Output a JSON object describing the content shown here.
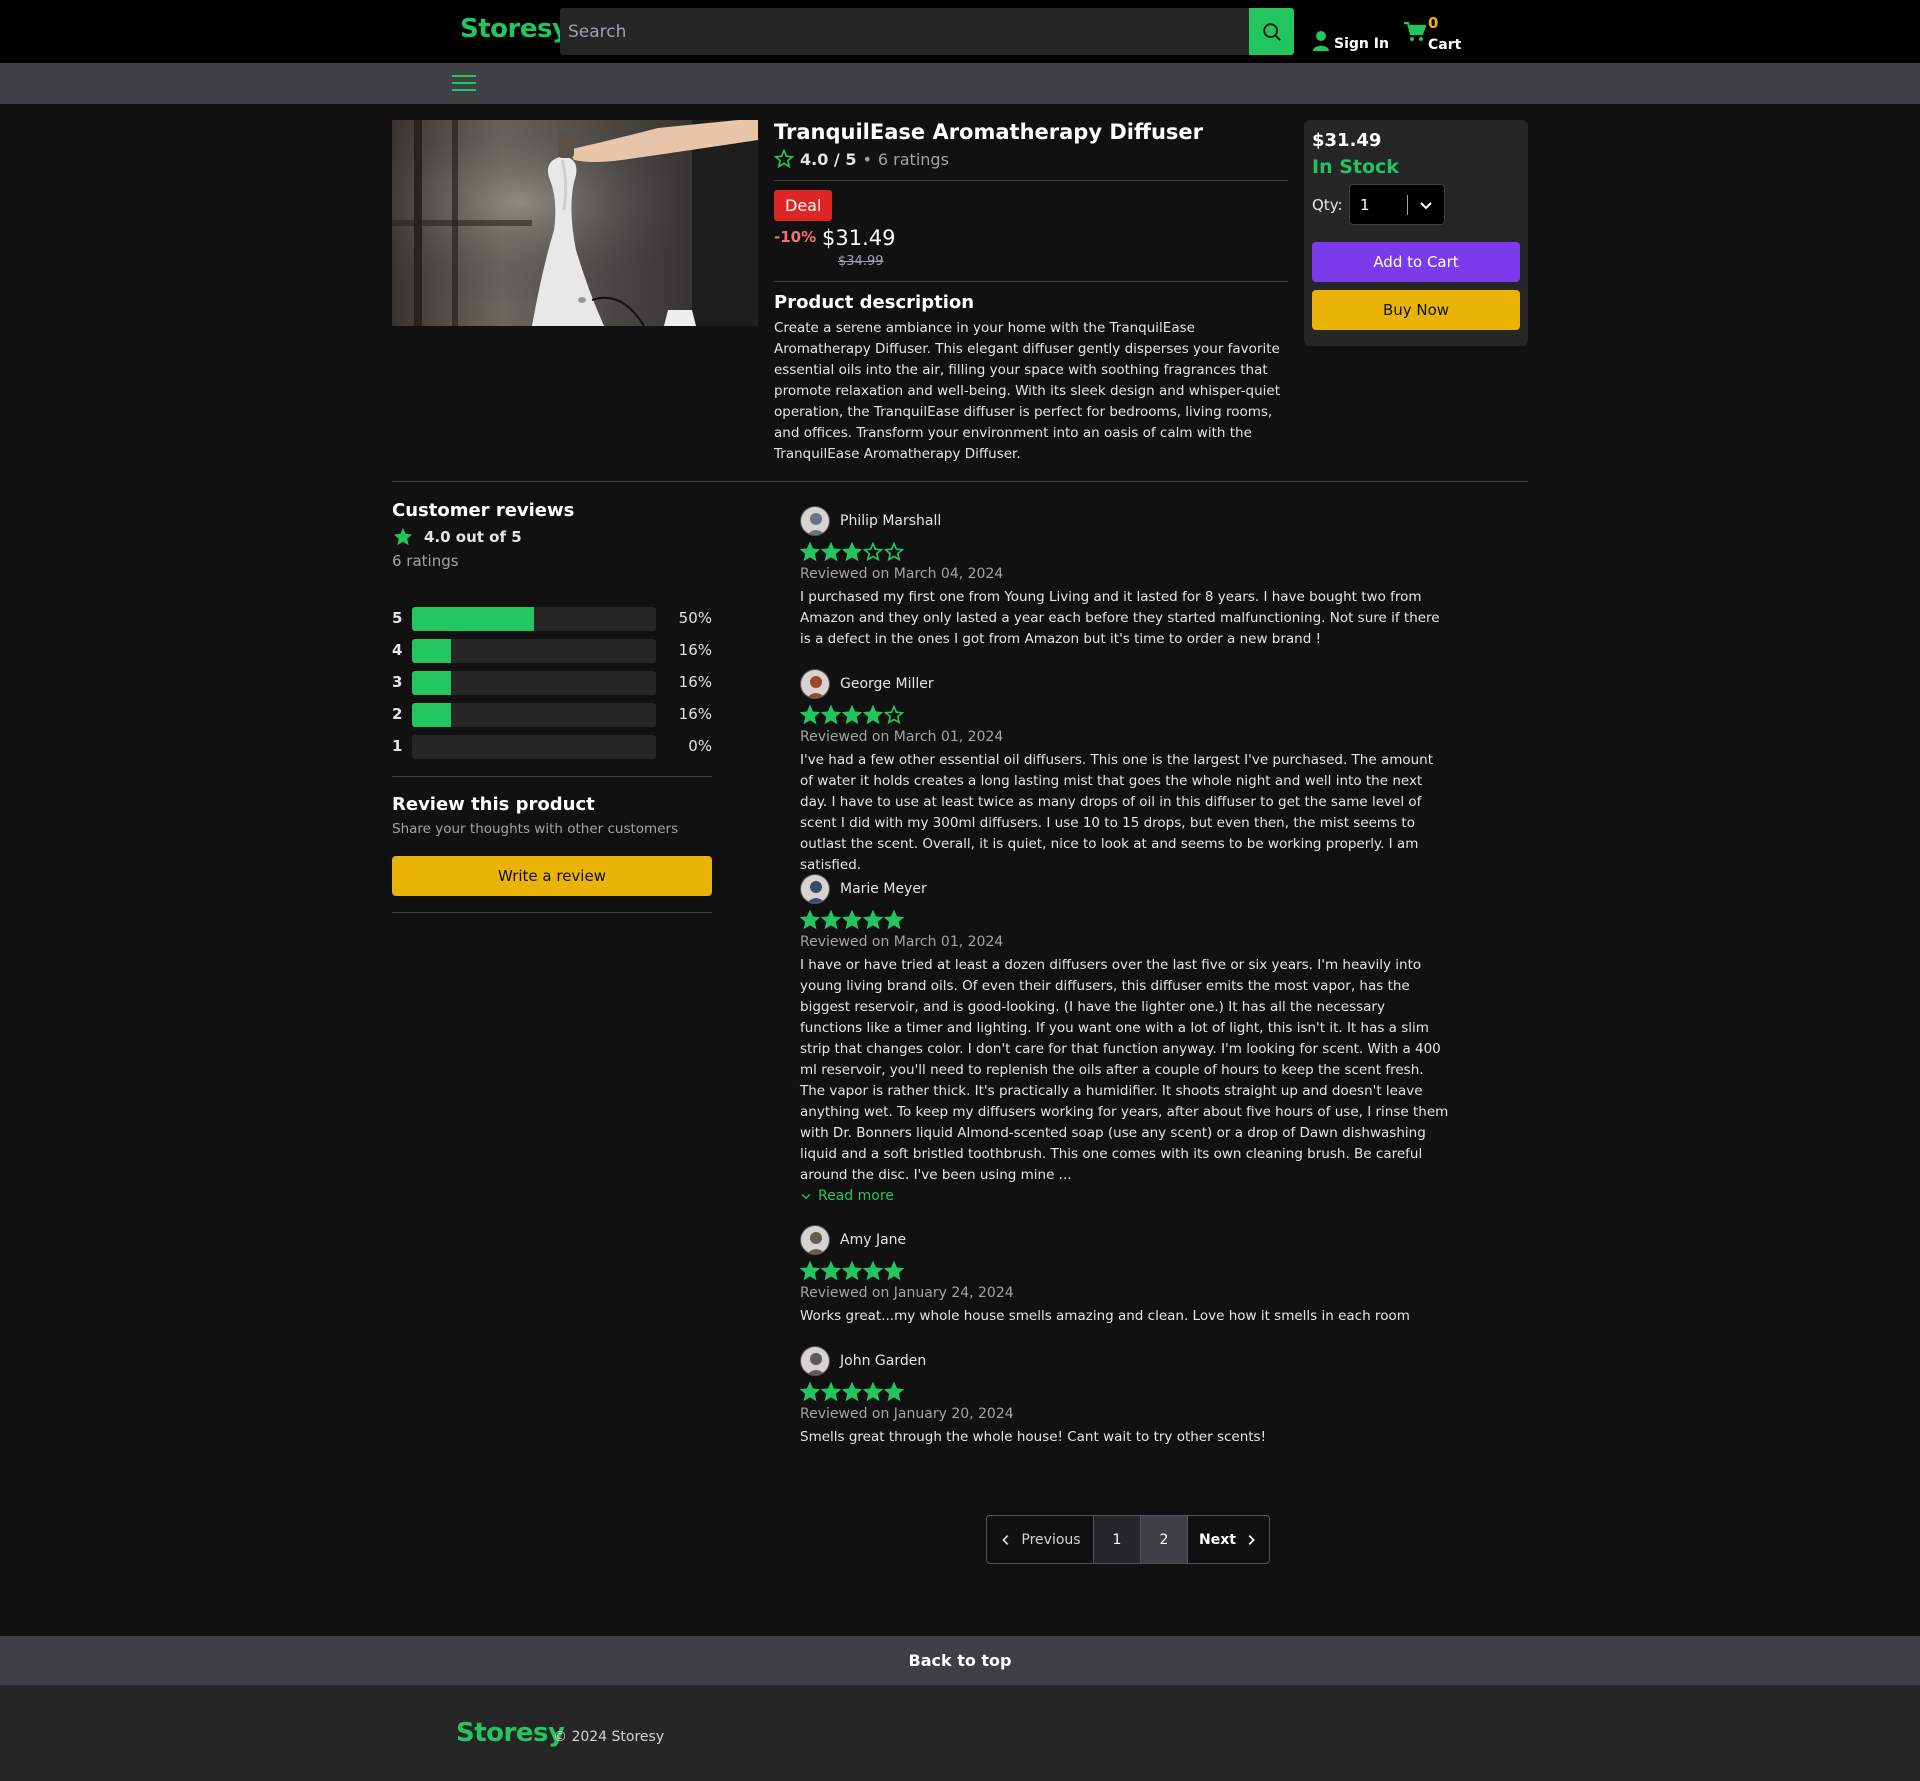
{
  "header": {
    "logo": "Storesy",
    "search_placeholder": "Search",
    "signin_label": "Sign In",
    "cart_count": "0",
    "cart_label": "Cart"
  },
  "product": {
    "title": "TranquilEase Aromatherapy Diffuser",
    "rating": "4.0 / 5",
    "rating_count": "6 ratings",
    "deal_badge": "Deal",
    "discount": "-10%",
    "price": "$31.49",
    "old_price": "$34.99",
    "description_title": "Product description",
    "description": "Create a serene ambiance in your home with the TranquilEase Aromatherapy Diffuser. This elegant diffuser gently disperses your favorite essential oils into the air, filling your space with soothing fragrances that promote relaxation and well-being. With its sleek design and whisper-quiet operation, the TranquilEase diffuser is perfect for bedrooms, living rooms, and offices. Transform your environment into an oasis of calm with the TranquilEase Aromatherapy Diffuser."
  },
  "buybox": {
    "price": "$31.49",
    "stock": "In Stock",
    "qty_label": "Qty:",
    "qty_value": "1",
    "add_to_cart": "Add to Cart",
    "buy_now": "Buy Now"
  },
  "summary": {
    "title": "Customer reviews",
    "rating": "4.0 out of 5",
    "count": "6 ratings",
    "bars": [
      {
        "star": "5",
        "pct": "50%",
        "fill": 0.5
      },
      {
        "star": "4",
        "pct": "16%",
        "fill": 0.16
      },
      {
        "star": "3",
        "pct": "16%",
        "fill": 0.16
      },
      {
        "star": "2",
        "pct": "16%",
        "fill": 0.16
      },
      {
        "star": "1",
        "pct": "0%",
        "fill": 0
      }
    ],
    "review_title": "Review this product",
    "review_sub": "Share your thoughts with other customers",
    "write_review": "Write a review"
  },
  "reviews": [
    {
      "name": "Philip Marshall",
      "stars": 3,
      "date": "Reviewed on March 04, 2024",
      "body": "I purchased my first one from Young Living and it lasted for 8 years. I have bought two from Amazon and they only lasted a year each before they started malfunctioning. Not sure if there is a defect in the ones I got from Amazon but it's time to order a new brand !"
    },
    {
      "name": "George Miller",
      "stars": 4,
      "date": "Reviewed on March 01, 2024",
      "body": "I've had a few other essential oil diffusers. This one is the largest I've purchased. The amount of water it holds creates a long lasting mist that goes the whole night and well into the next day. I have to use at least twice as many drops of oil in this diffuser to get the same level of scent I did with my 300ml diffusers. I use 10 to 15 drops, but even then, the mist seems to outlast the scent. Overall, it is quiet, nice to look at and seems to be working properly. I am satisfied."
    },
    {
      "name": "Marie Meyer",
      "stars": 5,
      "date": "Reviewed on March 01, 2024",
      "body": "I have or have tried at least a dozen diffusers over the last five or six years. I'm heavily into young living brand oils. Of even their diffusers, this diffuser emits the most vapor, has the biggest reservoir, and is good-looking. (I have the lighter one.) It has all the necessary functions like a timer and lighting. If you want one with a lot of light, this isn't it. It has a slim strip that changes color. I don't care for that function anyway. I'm looking for scent. With a 400 ml reservoir, you'll need to replenish the oils after a couple of hours to keep the scent fresh. The vapor is rather thick. It's practically a humidifier. It shoots straight up and doesn't leave anything wet. To keep my diffusers working for years, after about five hours of use, I rinse them with Dr. Bonners liquid Almond-scented soap (use any scent) or a drop of Dawn dishwashing liquid and a soft bristled toothbrush. This one comes with its own cleaning brush. Be careful around the disc. I've been using mine ...",
      "read_more": "Read more"
    },
    {
      "name": "Amy Jane",
      "stars": 5,
      "date": "Reviewed on January 24, 2024",
      "body": "Works great...my whole house smells amazing and clean. Love how it smells in each room"
    },
    {
      "name": "John Garden",
      "stars": 5,
      "date": "Reviewed on January 20, 2024",
      "body": "Smells great through the whole house! Cant wait to try other scents!"
    }
  ],
  "pagination": {
    "previous": "Previous",
    "page1": "1",
    "page2": "2",
    "next": "Next"
  },
  "footer": {
    "back_to_top": "Back to top",
    "logo": "Storesy",
    "copyright": "© 2024 Storesy"
  },
  "colors": {
    "accent": "#22c55e",
    "purple": "#7c3aed",
    "yellow": "#eab308",
    "deal_red": "#dc2626"
  }
}
